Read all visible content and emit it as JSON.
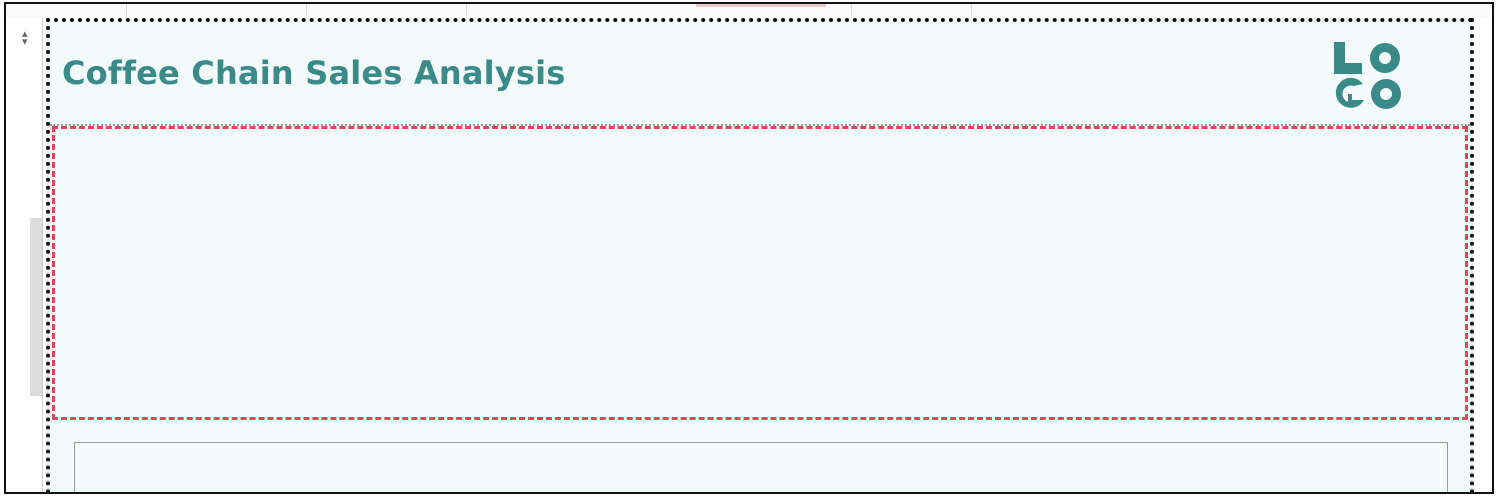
{
  "dashboard": {
    "title": "Coffee Chain Sales Analysis",
    "logo_text": "LOGO",
    "logo_color": "#3a8a8a",
    "title_color": "#3a8a8a",
    "background_color": "#f2fafa",
    "selection_border_color": "#e0455a"
  },
  "left_panel": {
    "resize_icon": "up-down-arrows-icon"
  }
}
